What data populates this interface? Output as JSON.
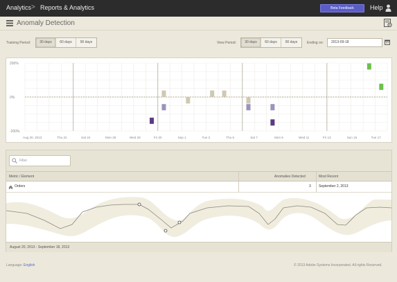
{
  "topbar": {
    "crumb_1": "Analytics",
    "separator": ">",
    "crumb_2": "Reports & Analytics",
    "beta_label": "Beta Feedback",
    "help_label": "Help",
    "beta_color": "#5a5dc8"
  },
  "title": {
    "text": "Anomaly Detection"
  },
  "controls": {
    "training_label": "Training Period:",
    "training_options": [
      "30 days",
      "60 days",
      "90 days"
    ],
    "training_selected": "30 days",
    "view_label": "View Period:",
    "view_options": [
      "30 days",
      "60 days",
      "90 days"
    ],
    "view_selected": "30 days",
    "ending_label": "Ending on:",
    "ending_value": "2013-09-18"
  },
  "chart_data": {
    "type": "bar",
    "y_tick_labels": [
      "200%",
      "0%",
      "-200%"
    ],
    "ylim": [
      -200,
      200
    ],
    "x_tick_labels": [
      "Aug 20, 2013",
      "Thu 22",
      "Sat 24",
      "Mon 26",
      "Wed 28",
      "Fri 30",
      "Sep 1",
      "Tue 3",
      "Thu 5",
      "Sat 7",
      "Mon 9",
      "Wed 11",
      "Fri 13",
      "Sun 15",
      "Tue 17"
    ],
    "days": 30,
    "baseline_dashed": true,
    "grid": true,
    "series": [
      {
        "color": "#cfc9b2",
        "points": [
          {
            "day": 12,
            "value": 20
          },
          {
            "day": 14,
            "value": -20
          },
          {
            "day": 16,
            "value": 20
          },
          {
            "day": 17,
            "value": 20
          },
          {
            "day": 19,
            "value": -20
          }
        ]
      },
      {
        "color": "#9b93bd",
        "points": [
          {
            "day": 12,
            "value": -60
          },
          {
            "day": 19,
            "value": -60
          },
          {
            "day": 21,
            "value": -60
          }
        ]
      },
      {
        "color": "#5c3a86",
        "points": [
          {
            "day": 11,
            "value": -140
          },
          {
            "day": 21,
            "value": -150
          }
        ]
      },
      {
        "color": "#6bc14e",
        "points": [
          {
            "day": 29,
            "value": 180
          },
          {
            "day": 30,
            "value": 60
          }
        ]
      }
    ]
  },
  "table": {
    "filter_placeholder": "Filter",
    "headers": [
      "Metric / Element",
      "Anomalies Detected",
      "Most Recent"
    ],
    "rows": [
      {
        "metric": "Orders",
        "anomalies": "3",
        "most_recent": "September 2, 2013"
      }
    ],
    "date_range": "August 20, 2013 - September 18, 2013"
  },
  "footer": {
    "language_label": "Language:",
    "language_value": "English",
    "copyright": "© 2013 Adobe Systems Incorporated. All rights Reserved."
  }
}
